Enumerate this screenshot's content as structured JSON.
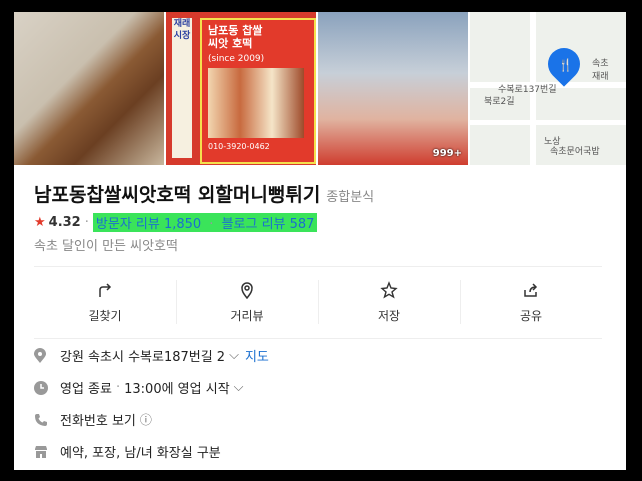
{
  "gallery": {
    "sign_title": "남포동 찹쌀\n씨앗 호떡",
    "sign_since": "(since 2009)",
    "sign_phone": "010-3920-0462",
    "vertical_text": "재래시장",
    "photo_count": "999+",
    "map_labels": [
      "수복로137번길",
      "북로2길",
      "노상",
      "속초문어국밥",
      "속초\n재래"
    ]
  },
  "place": {
    "name": "남포동찹쌀씨앗호떡 외할머니뻥튀기",
    "category": "종합분식",
    "rating": "4.32",
    "visitor_reviews": "방문자 리뷰 1,850",
    "blog_reviews": "블로그 리뷰 587",
    "description": "속초 달인이 만든 씨앗호떡"
  },
  "actions": [
    {
      "label": "길찾기",
      "icon": "directions-icon"
    },
    {
      "label": "거리뷰",
      "icon": "street-view-icon"
    },
    {
      "label": "저장",
      "icon": "star-icon"
    },
    {
      "label": "공유",
      "icon": "share-icon"
    }
  ],
  "info": {
    "address": "강원 속초시 수복로187번길 2",
    "map_link": "지도",
    "status": "영업 종료",
    "hours": "13:00에 영업 시작",
    "phone": "전화번호 보기",
    "facilities": "예약, 포장, 남/녀 화장실 구분"
  },
  "colors": {
    "accent": "#1a6fd0",
    "star": "#e23a2b",
    "highlight": "#3ae45a"
  }
}
